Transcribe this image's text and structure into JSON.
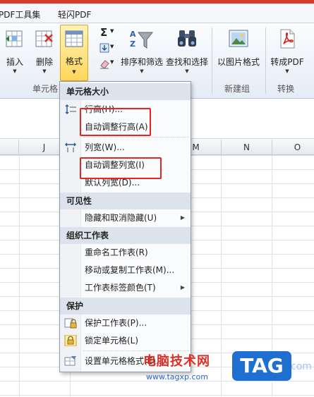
{
  "tabs": [
    "PDF工具集",
    "轻闪PDF"
  ],
  "ribbon": {
    "insert_label": "插入",
    "delete_label": "删除",
    "format_label": "格式",
    "sort_filter_label": "排序和筛选",
    "find_select_label": "查找和选择",
    "as_picture_label": "以图片格式",
    "to_pdf_label": "转成PDF",
    "group_cells": "单元格",
    "group_new": "新建组",
    "group_convert": "转换",
    "sigma_symbol": "Σ"
  },
  "columns": [
    "J",
    "M",
    "N",
    "O"
  ],
  "menu": {
    "cell_size_header": "单元格大小",
    "row_height": "行高(H)...",
    "autofit_row": "自动调整行高(A)",
    "col_width": "列宽(W)...",
    "autofit_col": "自动调整列宽(I)",
    "default_width": "默认列宽(D)...",
    "visibility_header": "可见性",
    "hide_unhide": "隐藏和取消隐藏(U)",
    "organize_header": "组织工作表",
    "rename_sheet": "重命名工作表(R)",
    "move_copy_sheet": "移动或复制工作表(M)...",
    "tab_color": "工作表标签颜色(T)",
    "protect_header": "保护",
    "protect_sheet": "保护工作表(P)...",
    "lock_cell": "锁定单元格(L)",
    "format_cells": "设置单元格格式(E)..."
  },
  "watermark": {
    "site_name": "电脑技术网",
    "url": "www.tagxp.com",
    "tag": "TAG",
    "ghost": "xz7.com"
  },
  "colors": {
    "highlight_box": "#e8241d",
    "format_button": "#ffd65b",
    "top_strip": "#d83b2a"
  }
}
